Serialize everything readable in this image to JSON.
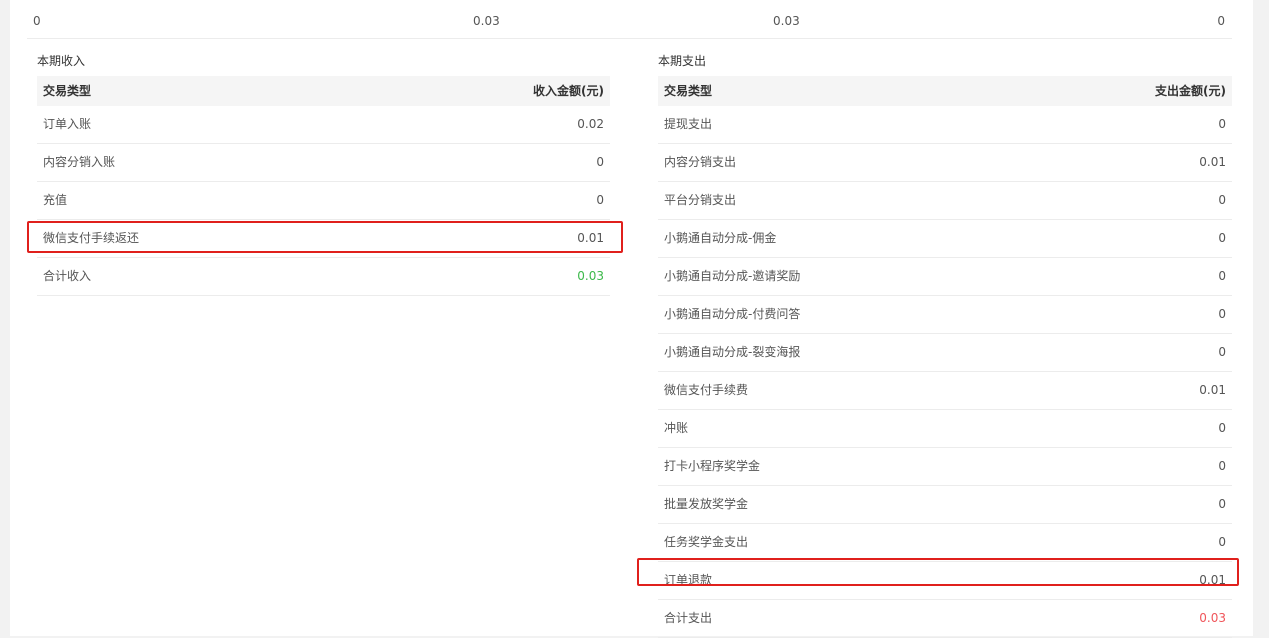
{
  "colors": {
    "income_total": "#3cb94a",
    "expense_total": "#f0555a",
    "highlight": "#e0201c"
  },
  "summary": {
    "values": [
      "0",
      "0.03",
      "0.03",
      "0"
    ]
  },
  "income": {
    "title": "本期收入",
    "header": {
      "type": "交易类型",
      "amount": "收入金额(元)"
    },
    "rows": [
      {
        "type": "订单入账",
        "amount": "0.02"
      },
      {
        "type": "内容分销入账",
        "amount": "0"
      },
      {
        "type": "充值",
        "amount": "0"
      },
      {
        "type": "微信支付手续返还",
        "amount": "0.01"
      }
    ],
    "total": {
      "type": "合计收入",
      "amount": "0.03"
    }
  },
  "expense": {
    "title": "本期支出",
    "header": {
      "type": "交易类型",
      "amount": "支出金额(元)"
    },
    "rows": [
      {
        "type": "提现支出",
        "amount": "0"
      },
      {
        "type": "内容分销支出",
        "amount": "0.01"
      },
      {
        "type": "平台分销支出",
        "amount": "0"
      },
      {
        "type": "小鹅通自动分成-佣金",
        "amount": "0"
      },
      {
        "type": "小鹅通自动分成-邀请奖励",
        "amount": "0"
      },
      {
        "type": "小鹅通自动分成-付费问答",
        "amount": "0"
      },
      {
        "type": "小鹅通自动分成-裂变海报",
        "amount": "0"
      },
      {
        "type": "微信支付手续费",
        "amount": "0.01"
      },
      {
        "type": "冲账",
        "amount": "0"
      },
      {
        "type": "打卡小程序奖学金",
        "amount": "0"
      },
      {
        "type": "批量发放奖学金",
        "amount": "0"
      },
      {
        "type": "任务奖学金支出",
        "amount": "0"
      },
      {
        "type": "订单退款",
        "amount": "0.01"
      }
    ],
    "total": {
      "type": "合计支出",
      "amount": "0.03"
    }
  }
}
